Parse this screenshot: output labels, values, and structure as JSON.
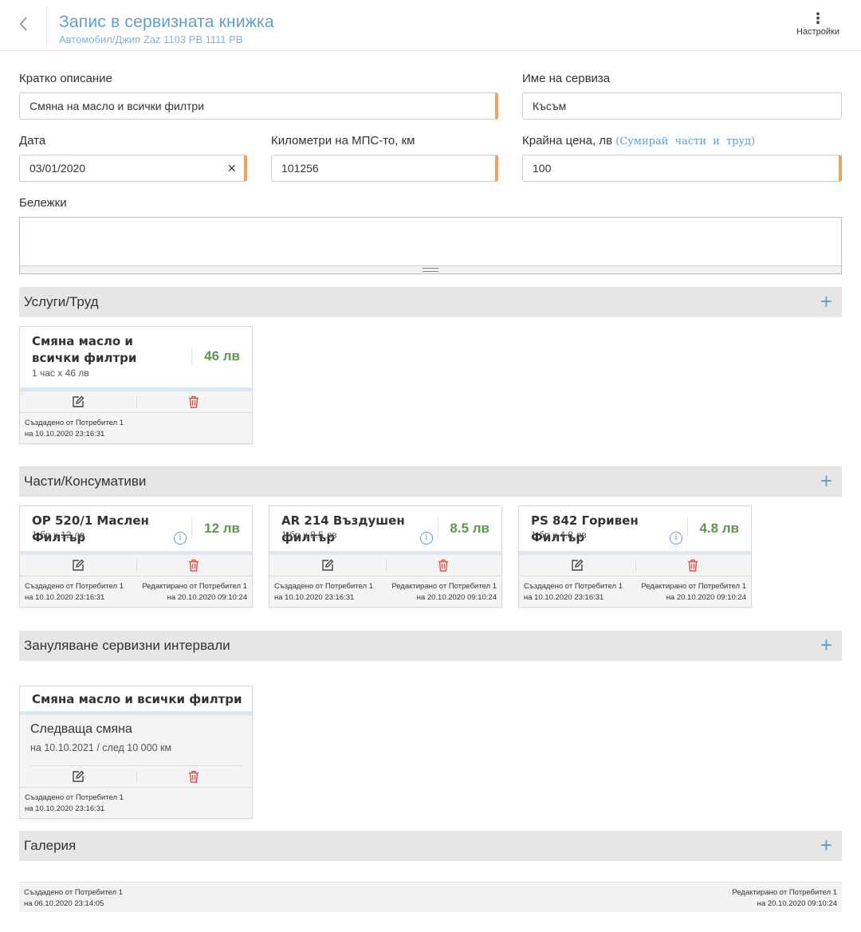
{
  "header": {
    "title": "Запис в сервизната книжка",
    "subtitle": "Автомобил/Джип Zaz 1103 PB 1111 PB",
    "settings_label": "Настройки"
  },
  "form": {
    "short_description": {
      "label": "Кратко описание",
      "value": "Смяна на масло и всички филтри"
    },
    "service_name": {
      "label": "Име на сервиза",
      "value": "Късъм"
    },
    "date": {
      "label": "Дата",
      "value": "03/01/2020",
      "clear": "×"
    },
    "km": {
      "label": "Километри на МПС-то, км",
      "value": "101256"
    },
    "price": {
      "label": "Крайна цена, лв",
      "sum_link": "(Сумирай части и труд)",
      "value": "100"
    },
    "notes": {
      "label": "Бележки",
      "value": ""
    }
  },
  "sections": {
    "labor": {
      "title": "Услуги/Труд",
      "add": "+"
    },
    "parts": {
      "title": "Части/Консумативи",
      "add": "+"
    },
    "reset": {
      "title": "Зануляване сервизни интервали",
      "add": "+"
    },
    "gallery": {
      "title": "Галерия",
      "add": "+"
    }
  },
  "labor_cards": [
    {
      "title": "Смяна масло и всички филтри",
      "detail": "1 час x 46 лв",
      "price": "46 лв",
      "created_by": "Създадено от Потребител 1",
      "created_at": "на 10.10.2020 23:16:31"
    }
  ],
  "part_cards": [
    {
      "title": "OP 520/1 Маслен Филтър",
      "detail": "1 бр x 12 лв",
      "price": "12 лв",
      "created_by": "Създадено от Потребител 1",
      "created_at": "на 10.10.2020 23:16:31",
      "edited_by": "Редактирано от Потребител 1",
      "edited_at": "на 20.10.2020 09:10:24"
    },
    {
      "title": "AR 214 Въздушен филтър",
      "detail": "1 бр x 8.5 лв",
      "price": "8.5 лв",
      "created_by": "Създадено от Потребител 1",
      "created_at": "на 10.10.2020 23:16:31",
      "edited_by": "Редактирано от Потребител 1",
      "edited_at": "на 20.10.2020 09:10:24"
    },
    {
      "title": "PS 842 Горивен Филтър",
      "detail": "1 бр x 4.8 лв",
      "price": "4.8 лв",
      "created_by": "Създадено от Потребител 1",
      "created_at": "на 10.10.2020 23:16:31",
      "edited_by": "Редактирано от Потребител 1",
      "edited_at": "на 20.10.2020 09:10:24"
    }
  ],
  "reset_cards": [
    {
      "title": "Смяна масло и всички филтри",
      "next_label": "Следваща смяна",
      "next_detail": "на 10.10.2021 / след 10 000 км",
      "created_by": "Създадено от Потребител 1",
      "created_at": "на 10.10.2020 23:16:31"
    }
  ],
  "record_meta": {
    "created_by": "Създадено от Потребител 1",
    "created_at": "на 06.10.2020 23:14:05",
    "edited_by": "Редактирано от Потребител 1",
    "edited_at": "на 20.10.2020 09:10:24"
  },
  "icons": {
    "back": "chevron-left-icon",
    "settings": "more-vertical-icon",
    "edit": "edit-icon",
    "delete": "trash-icon",
    "info": "info-icon",
    "add": "plus-icon"
  },
  "colors": {
    "accent": "#5a9fcf",
    "price": "#5b9a4a",
    "delete": "#d9534f",
    "required_marker": "#f0a35e"
  }
}
